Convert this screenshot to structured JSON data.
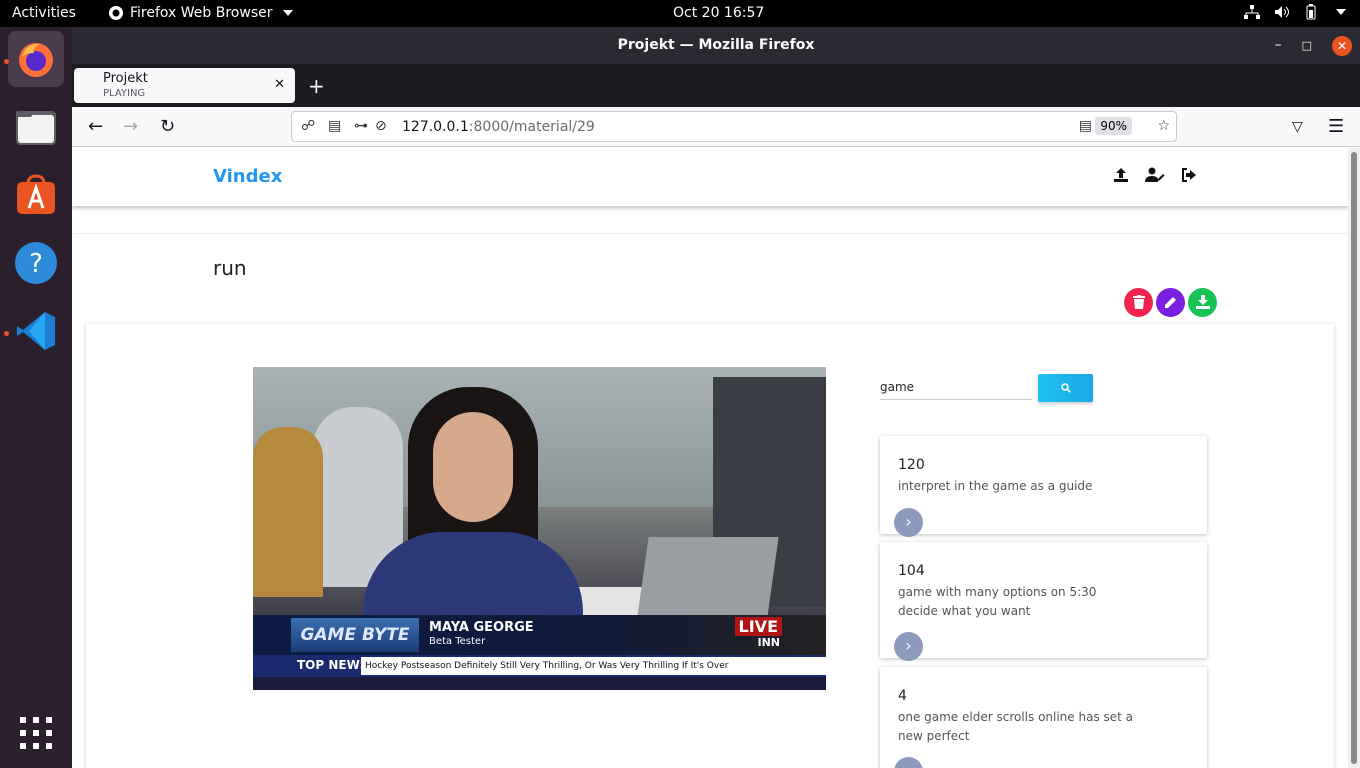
{
  "system": {
    "activities_label": "Activities",
    "app_menu_label": "Firefox Web Browser",
    "clock": "Oct 20  16:57"
  },
  "dock": {
    "items": [
      "firefox-icon",
      "files-icon",
      "software-icon",
      "help-icon",
      "vscode-icon"
    ],
    "grid_icon": "show-apps-icon"
  },
  "browser": {
    "window_title": "Projekt — Mozilla Firefox",
    "tab": {
      "title": "Projekt",
      "status": "PLAYING"
    },
    "url_host": "127.0.0.1",
    "url_path": ":8000/material/29",
    "zoom": "90%"
  },
  "app": {
    "brand": "Vindex",
    "material_title": "run",
    "colors": {
      "brand": "#2196f3",
      "delete": "#f0244f",
      "edit": "#7b1fe0",
      "download": "#17c353"
    }
  },
  "video": {
    "show_name": "GAME BYTE",
    "person_name": "MAYA GEORGE",
    "person_role": "Beta Tester",
    "live_label": "LIVE",
    "network": "INN",
    "ticker_label": "TOP NEWS",
    "ticker_text": "Hockey Postseason Definitely Still Very Thrilling, Or Was Very Thrilling If It's Over"
  },
  "search": {
    "value": "game"
  },
  "results": [
    {
      "time": "120",
      "text": "interpret in the game as a guide"
    },
    {
      "time": "104",
      "text": "game with many options on 5:30 decide what you want"
    },
    {
      "time": "4",
      "text": "one game elder scrolls online has set a new perfect"
    }
  ]
}
